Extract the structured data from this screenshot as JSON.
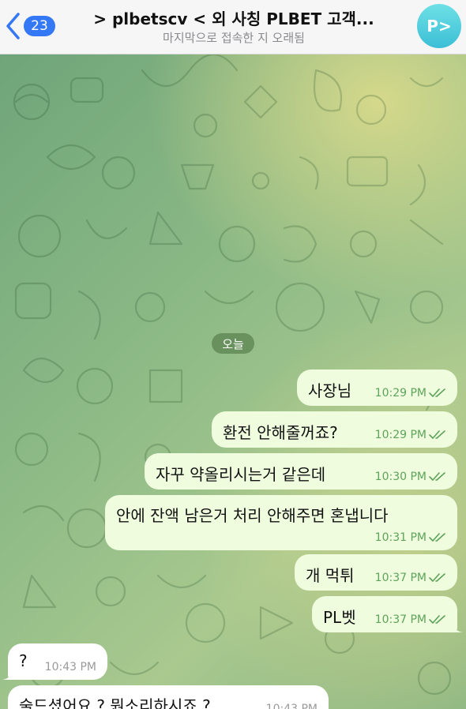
{
  "header": {
    "back_count": "23",
    "title": "> plbetscv < 외 사칭 PLBET 고객...",
    "status": "마지막으로 접속한 지 오래됨",
    "avatar_initials": "P>"
  },
  "date_separator": "오늘",
  "messages": [
    {
      "direction": "outgoing",
      "text": "사장님",
      "time": "10:29 PM",
      "read": true
    },
    {
      "direction": "outgoing",
      "text": "환전 안해줄꺼죠?",
      "time": "10:29 PM",
      "read": true
    },
    {
      "direction": "outgoing",
      "text": "자꾸 약올리시는거 같은데",
      "time": "10:30 PM",
      "read": true
    },
    {
      "direction": "outgoing",
      "text": "안에 잔액 남은거 처리 안해주면 혼냅니다",
      "time": "10:31 PM",
      "read": true
    },
    {
      "direction": "outgoing",
      "text": "개 먹튀",
      "time": "10:37 PM",
      "read": true
    },
    {
      "direction": "outgoing",
      "text": "PL벳",
      "time": "10:37 PM",
      "read": true
    },
    {
      "direction": "incoming",
      "text": "?",
      "time": "10:43 PM"
    },
    {
      "direction": "incoming",
      "text": "술드셨어요 ? 뭔소리하시죠 ?",
      "time": "10:43 PM"
    }
  ],
  "colors": {
    "outgoing_bubble": "#effdde",
    "incoming_bubble": "#ffffff",
    "read_check": "#5da35a",
    "accent": "#3478f6"
  }
}
